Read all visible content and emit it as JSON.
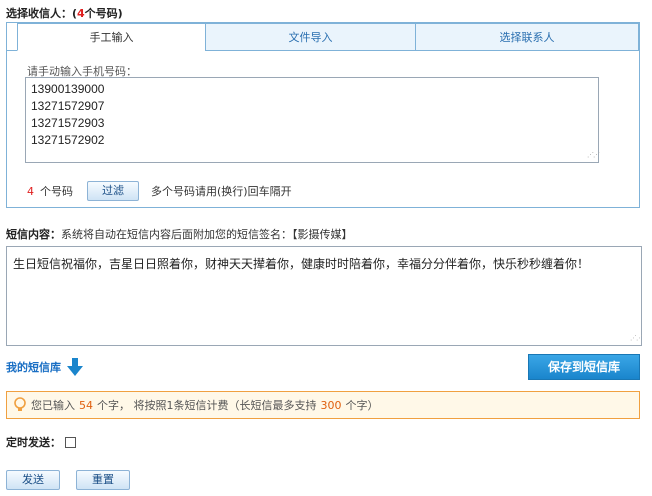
{
  "recipients": {
    "title_prefix": "选择收信人：(",
    "count": "4",
    "title_suffix": "个号码)",
    "tabs": [
      "手工输入",
      "文件导入",
      "选择联系人"
    ],
    "input_label": "请手动输入手机号码：",
    "numbers": "13900139000\n13271572907\n13271572903\n13271572902",
    "count_value": "4",
    "count_unit": "个号码",
    "filter_button": "过滤",
    "hint": "多个号码请用(换行)回车隔开"
  },
  "content": {
    "label": "短信内容：",
    "note": "系统将自动在短信内容后面附加您的短信签名：【影摄传媒】",
    "message": "生日短信祝福你，吉星日日照着你，财神天天撵着你，健康时时陪着你，幸福分分伴着你，快乐秒秒缠着你！",
    "library_link": "我的短信库",
    "save_button": "保存到短信库"
  },
  "notice": {
    "prefix": "您已输入",
    "chars": "54",
    "middle": "个字，  将按照1条短信计费（长短信最多支持",
    "max": "300",
    "suffix": "个字）"
  },
  "schedule": {
    "label": "定时发送："
  },
  "actions": {
    "send": "发送",
    "reset": "重置"
  },
  "colors": {
    "accent": "#1a85cc",
    "highlight": "#e02020",
    "notice_border": "#f0a040"
  }
}
